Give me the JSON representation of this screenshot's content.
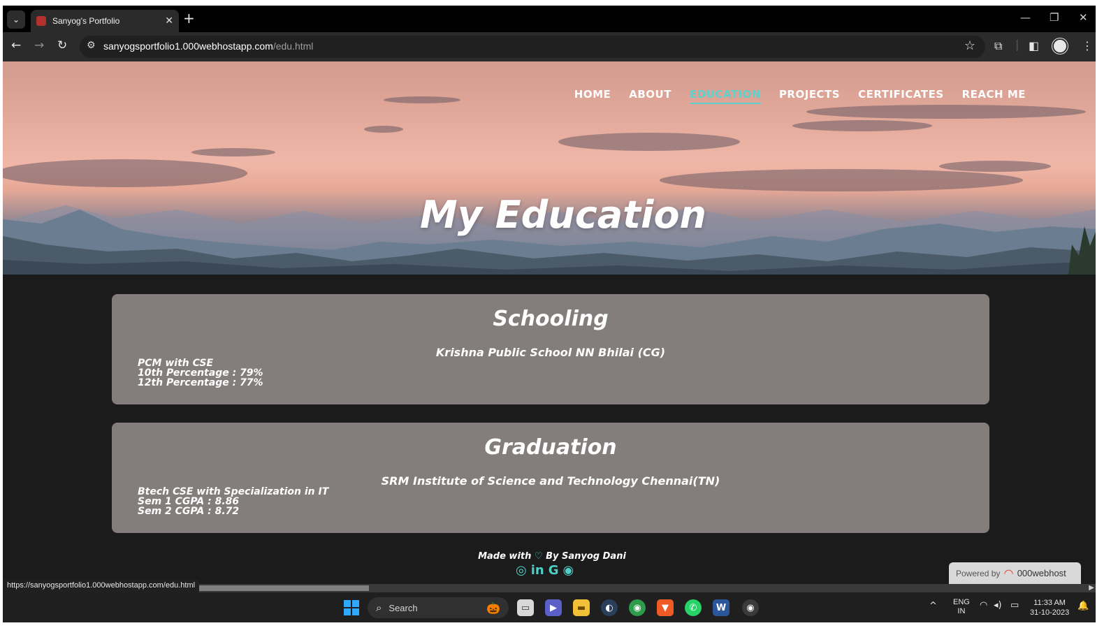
{
  "browser": {
    "tab_dropdown_icon": "chevron-down-icon",
    "tab_title": "Sanyog's Portfolio",
    "tab_close": "✕",
    "new_tab": "+",
    "window_controls": {
      "minimize": "—",
      "restore": "❐",
      "close": "✕"
    },
    "url_host": "sanyogsportfolio1.000webhostapp.com",
    "url_path": "/edu.html",
    "status_url": "https://sanyogsportfolio1.000webhostapp.com/edu.html"
  },
  "site": {
    "nav": [
      "HOME",
      "ABOUT",
      "EDUCATION",
      "PROJECTS",
      "CERTIFICATES",
      "REACH ME"
    ],
    "active_nav": "EDUCATION",
    "hero_title": "My Education",
    "accent_color": "#5fd1cd",
    "cards": [
      {
        "heading": "Schooling",
        "institution": "Krishna Public School NN Bhilai (CG)",
        "lines": [
          "PCM with CSE",
          "10th Percentage : 79%",
          "12th Percentage : 77%"
        ]
      },
      {
        "heading": "Graduation",
        "institution": "SRM Institute of Science and Technology Chennai(TN)",
        "lines": [
          "Btech CSE with Specialization in IT",
          "Sem 1 CGPA : 8.86",
          "Sem 2 CGPA : 8.72"
        ]
      }
    ],
    "footer": {
      "made_with": "Made with",
      "by": "By Sanyog Dani"
    },
    "socials": [
      "instagram-icon",
      "linkedin-icon",
      "google-icon",
      "github-icon"
    ],
    "powered_by": {
      "label": "Powered by",
      "brand": "000webhost"
    }
  },
  "taskbar": {
    "search_label": "Search",
    "apps": [
      "task-view-icon",
      "meet-icon",
      "file-explorer-icon",
      "steam-icon",
      "chrome-icon",
      "brave-icon",
      "whatsapp-icon",
      "word-icon",
      "chrome-profile-icon"
    ],
    "language": "ENG",
    "region": "IN",
    "time": "11:33 AM",
    "date": "31-10-2023"
  }
}
